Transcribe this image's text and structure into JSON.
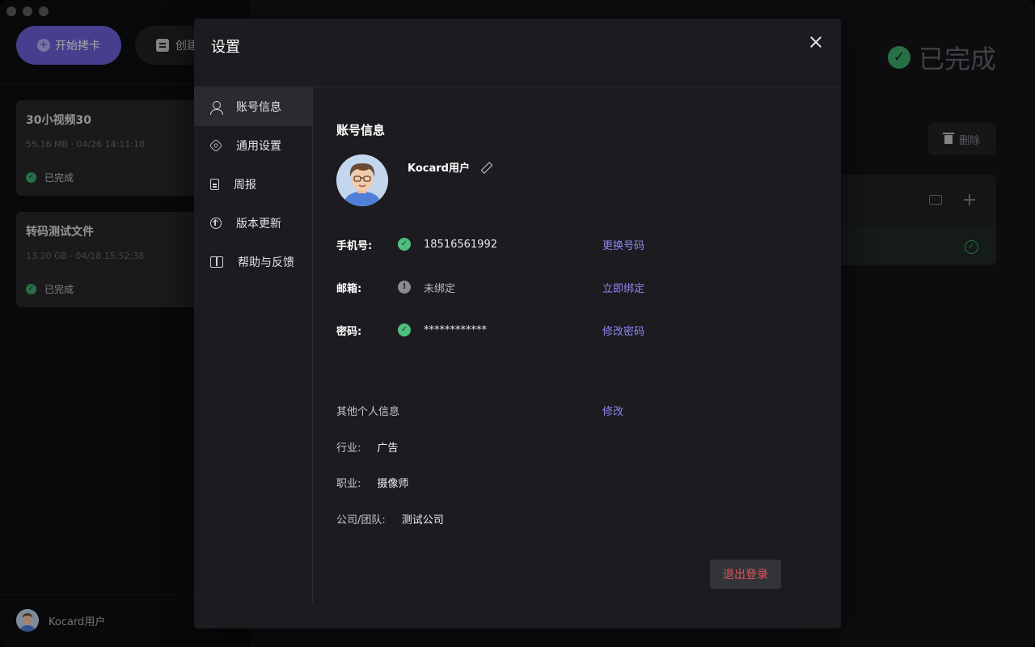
{
  "app": {
    "start_button": "开始拷卡",
    "create_button": "创建",
    "tasks": [
      {
        "title": "30小视频30",
        "meta": "55.16 MB · 04/26 14:11:18",
        "status": "已完成"
      },
      {
        "title": "转码测试文件",
        "meta": "13.20 GB · 04/18 15:52:38",
        "status": "已完成"
      }
    ],
    "footer_user": "Kocard用户",
    "right_status": "已完成",
    "delete_button": "删除"
  },
  "settings": {
    "title": "设置",
    "nav": [
      {
        "label": "账号信息",
        "icon": "user-icon",
        "active": true
      },
      {
        "label": "通用设置",
        "icon": "gear-icon",
        "active": false
      },
      {
        "label": "周报",
        "icon": "document-icon",
        "active": false
      },
      {
        "label": "版本更新",
        "icon": "upload-icon",
        "active": false
      },
      {
        "label": "帮助与反馈",
        "icon": "book-icon",
        "active": false
      }
    ],
    "account": {
      "section_title": "账号信息",
      "username": "Kocard用户",
      "phone": {
        "label": "手机号:",
        "value": "18516561992",
        "action": "更换号码"
      },
      "email": {
        "label": "邮箱:",
        "value": "未绑定",
        "action": "立即绑定"
      },
      "password": {
        "label": "密码:",
        "value": "************",
        "action": "修改密码"
      },
      "other_title": "其他个人信息",
      "other_action": "修改",
      "industry": {
        "label": "行业:",
        "value": "广告"
      },
      "job": {
        "label": "职业:",
        "value": "摄像师"
      },
      "company": {
        "label": "公司/团队:",
        "value": "测试公司"
      },
      "logout": "退出登录"
    }
  },
  "colors": {
    "accent": "#6b62d9",
    "link": "#8f86f2",
    "success": "#4fbf80",
    "danger": "#e05757"
  }
}
